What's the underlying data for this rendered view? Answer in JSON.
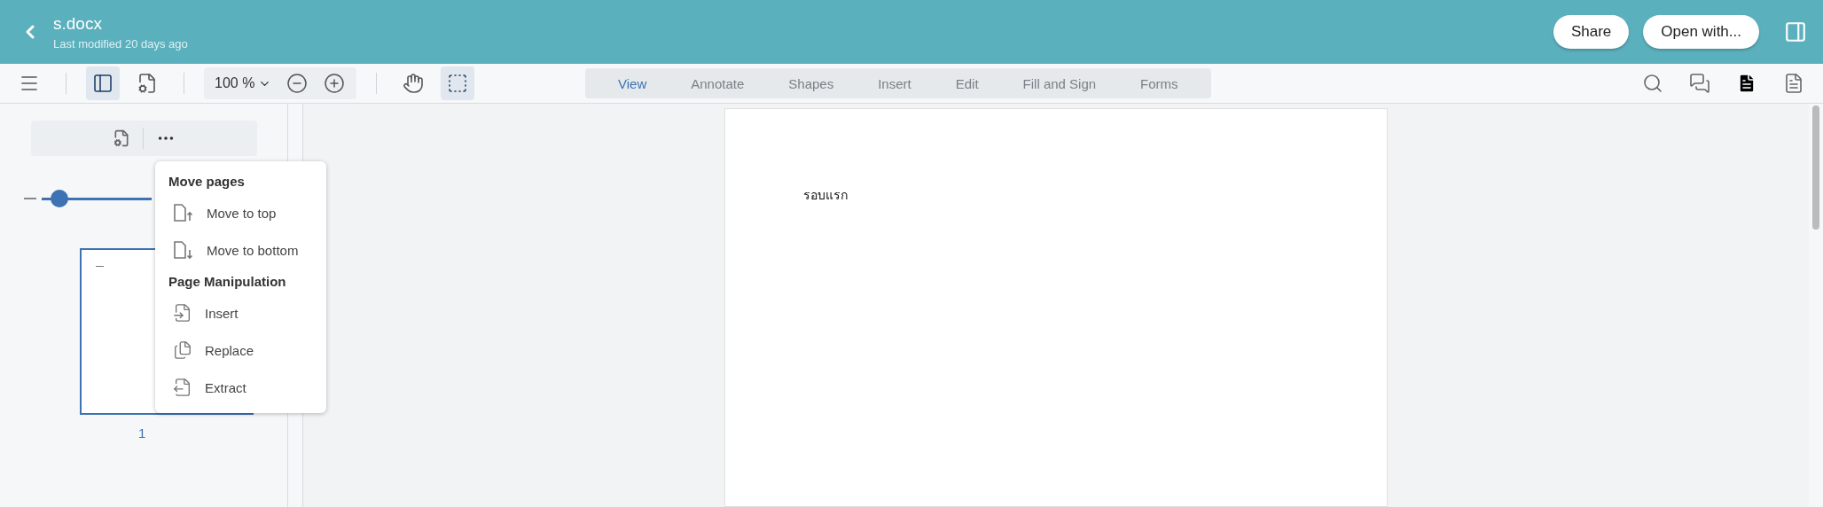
{
  "header": {
    "title": "s.docx",
    "subtitle": "Last modified 20 days ago",
    "buttons": [
      {
        "label": "Share"
      },
      {
        "label": "Open with..."
      }
    ]
  },
  "toolbar": {
    "tools": [
      {
        "kind": "menu",
        "selected": false
      },
      {
        "kind": "panel",
        "selected": true
      },
      {
        "kind": "doc-settings",
        "selected": false
      },
      {
        "kind": "zoom",
        "label": "100 %"
      },
      {
        "kind": "pan",
        "selected": false
      },
      {
        "kind": "select",
        "selected": true
      }
    ],
    "right_tools": [
      {
        "kind": "search"
      },
      {
        "kind": "comments"
      },
      {
        "kind": "file"
      },
      {
        "kind": "notes"
      }
    ]
  },
  "tabs": [
    {
      "label": "View",
      "selected": true
    },
    {
      "label": "Annotate",
      "selected": false
    },
    {
      "label": "Shapes",
      "selected": false
    },
    {
      "label": "Insert",
      "selected": false
    },
    {
      "label": "Edit",
      "selected": false
    },
    {
      "label": "Fill and Sign",
      "selected": false
    },
    {
      "label": "Forms",
      "selected": false
    }
  ],
  "sidebar": {
    "slider": {
      "level": 0.16
    },
    "thumbnails": [
      {
        "page_number": "1",
        "selected": true
      }
    ]
  },
  "menu": {
    "sections": [
      {
        "heading": "Move pages",
        "items": [
          {
            "label": "Move to top",
            "kind": "move-up"
          },
          {
            "label": "Move to bottom",
            "kind": "move-down"
          }
        ]
      },
      {
        "heading": "Page Manipulation",
        "items": [
          {
            "label": "Insert",
            "kind": "insert"
          },
          {
            "label": "Replace",
            "kind": "replace"
          },
          {
            "label": "Extract",
            "kind": "extract"
          }
        ]
      }
    ]
  },
  "document": {
    "text": "รอบแรก"
  }
}
